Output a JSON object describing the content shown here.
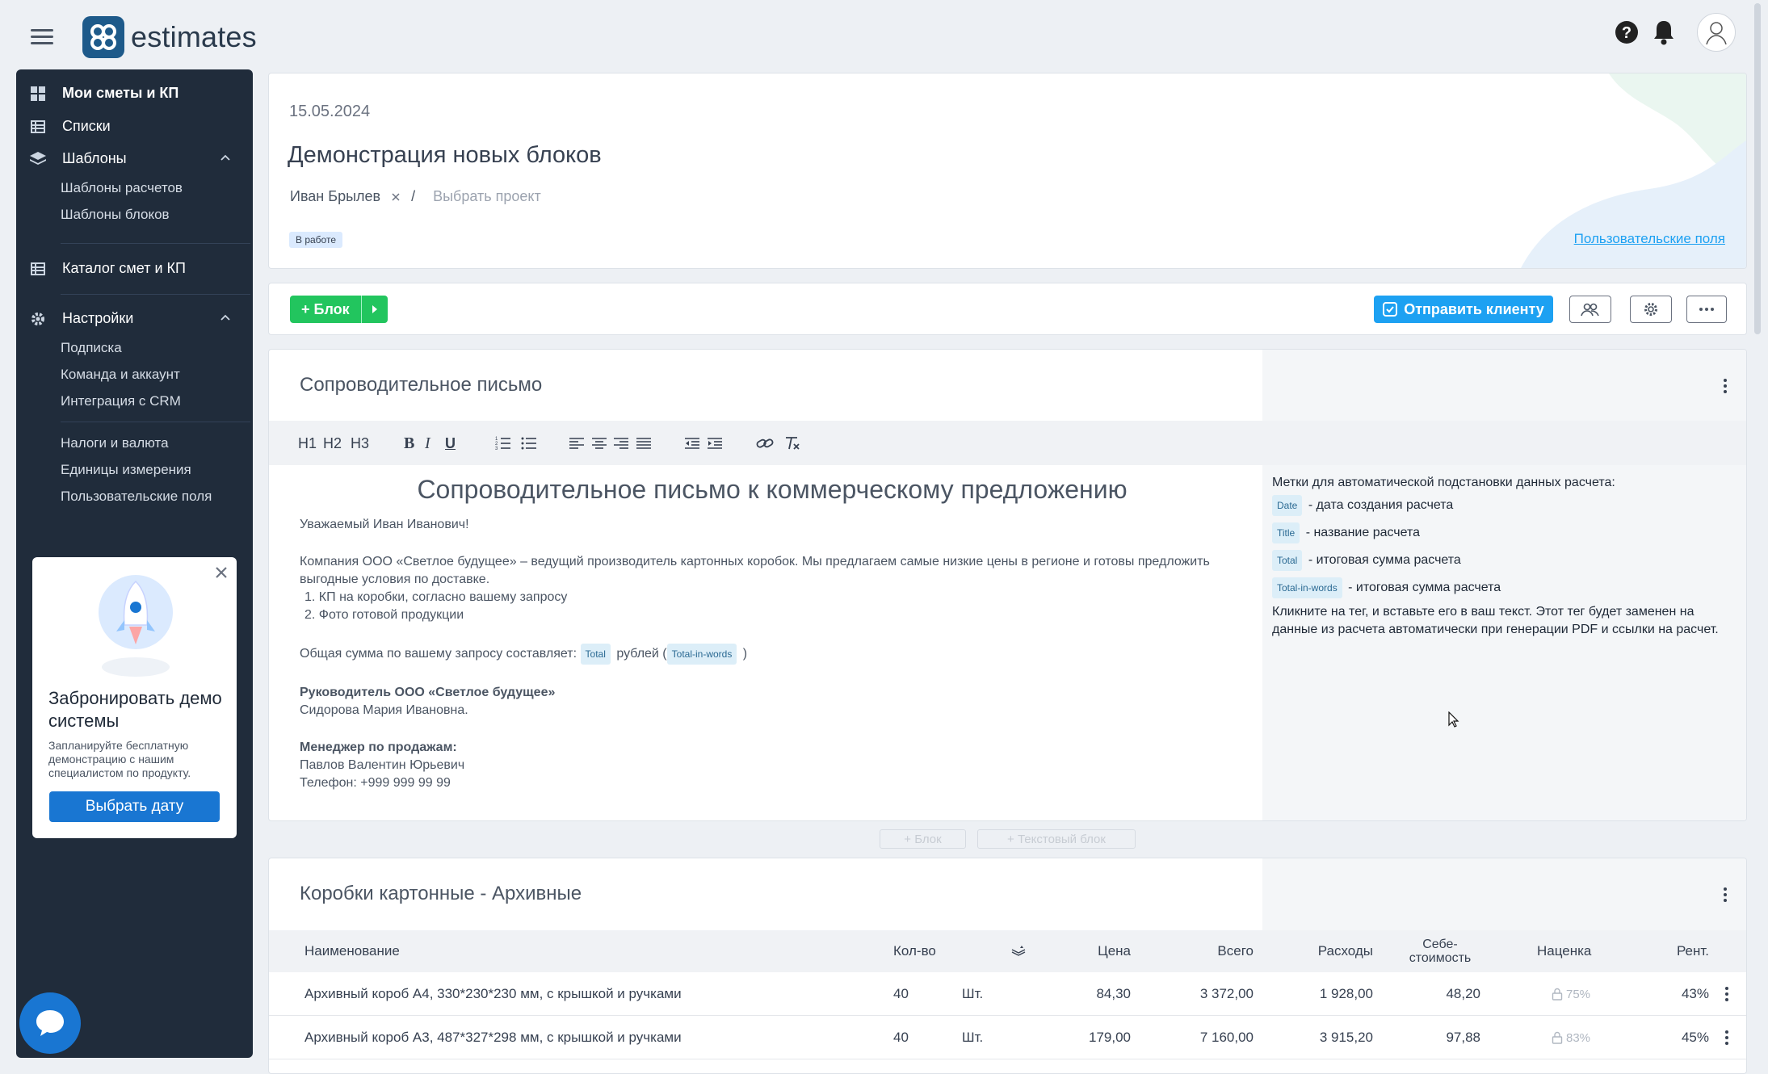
{
  "app": {
    "name": "estimates"
  },
  "sidebar": {
    "items": [
      {
        "label": "Мои сметы и КП",
        "icon": "grid-icon"
      },
      {
        "label": "Списки",
        "icon": "list-icon"
      },
      {
        "label": "Шаблоны",
        "icon": "layers-icon"
      },
      {
        "label": "Каталог смет и КП",
        "icon": "catalog-icon"
      },
      {
        "label": "Настройки",
        "icon": "gear-icon"
      }
    ],
    "templates_sub": [
      "Шаблоны расчетов",
      "Шаблоны блоков"
    ],
    "settings_sub": [
      "Подписка",
      "Команда и аккаунт",
      "Интеграция с CRM",
      "Налоги и валюта",
      "Единицы измерения",
      "Пользовательские поля"
    ]
  },
  "promo": {
    "title": "Забронировать демо системы",
    "text": "Запланируйте бесплатную демонстрацию с нашим специалистом по продукту.",
    "button": "Выбрать дату"
  },
  "header": {
    "date": "15.05.2024",
    "title": "Демонстрация новых блоков",
    "client": "Иван Брылев",
    "separator": "/",
    "project_placeholder": "Выбрать проект",
    "status": "В работе",
    "custom_fields_link": "Пользовательские поля"
  },
  "toolbar": {
    "add_block": "+ Блок",
    "send_client": "Отправить клиенту"
  },
  "letter_block": {
    "title": "Сопроводительное письмо",
    "editor_buttons": [
      "H1",
      "H2",
      "H3"
    ],
    "heading": "Сопроводительное письмо к коммерческому предложению",
    "greeting": "Уважаемый Иван Иванович!",
    "paragraph": "Компания ООО «Светлое будущее» – ведущий производитель картонных коробок. Мы предлагаем самые низкие цены в регионе и готовы предложить выгодные условия по доставке.",
    "list": [
      "КП на коробки, согласно вашему запросу",
      "Фото готовой продукции"
    ],
    "total_prefix": "Общая сумма по вашему запросу составляет:",
    "total_chip": "Total",
    "total_mid": "рублей (",
    "total_words_chip": "Total-in-words",
    "total_suffix": ")",
    "director_title": "Руководитель ООО «Светлое будущее»",
    "director_name": "Сидорова Мария Ивановна.",
    "manager_title": "Менеджер по продажам:",
    "manager_name": "Павлов Валентин Юрьевич",
    "manager_phone": "Телефон: +999 999 99 99"
  },
  "tags_panel": {
    "intro": "Метки для автоматической подстановки данных расчета:",
    "tags": [
      {
        "tag": "Date",
        "desc": "- дата создания расчета"
      },
      {
        "tag": "Title",
        "desc": "- название расчета"
      },
      {
        "tag": "Total",
        "desc": "- итоговая сумма расчета"
      },
      {
        "tag": "Total-in-words",
        "desc": "- итоговая сумма расчета"
      }
    ],
    "hint": "Кликните на тег, и вставьте его в ваш текст. Этот тег будет заменен на данные из расчета автоматически при генерации PDF и ссылки на расчет."
  },
  "between": {
    "add_block": "+ Блок",
    "add_text_block": "+ Текстовый блок"
  },
  "table_block": {
    "title": "Коробки картонные - Архивные",
    "columns": {
      "name": "Наименование",
      "qty": "Кол-во",
      "price": "Цена",
      "total": "Всего",
      "expenses": "Расходы",
      "cost_line1": "Себе-",
      "cost_line2": "стоимость",
      "markup": "Наценка",
      "profit": "Рент."
    },
    "rows": [
      {
        "name": "Архивный короб А4, 330*230*230 мм, с крышкой и ручками",
        "qty": "40",
        "unit": "Шт.",
        "price": "84,30",
        "total": "3 372,00",
        "expenses": "1 928,00",
        "cost": "48,20",
        "markup": "75%",
        "profit": "43%"
      },
      {
        "name": "Архивный короб А3, 487*327*298 мм, с крышкой и ручками",
        "qty": "40",
        "unit": "Шт.",
        "price": "179,00",
        "total": "7 160,00",
        "expenses": "3 915,20",
        "cost": "97,88",
        "markup": "83%",
        "profit": "45%"
      }
    ]
  },
  "colors": {
    "sidebar": "#202c3b",
    "accent_green": "#22c55e",
    "accent_blue": "#1da1f2",
    "primary": "#1976d2"
  }
}
